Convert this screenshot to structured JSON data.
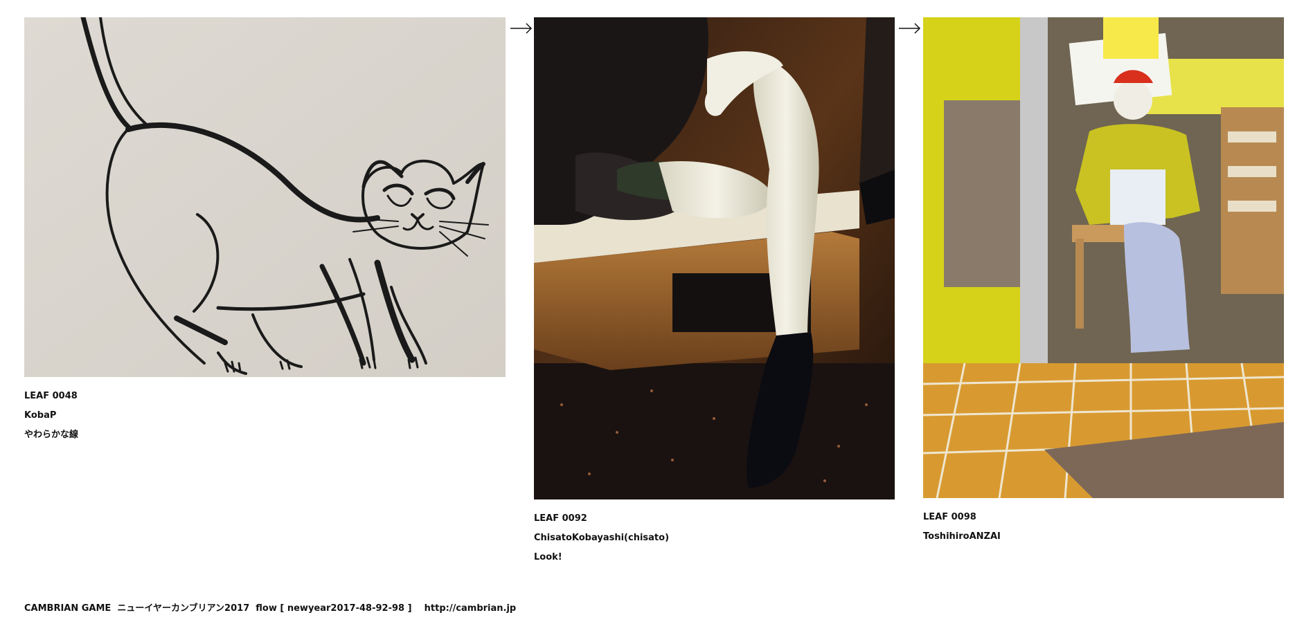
{
  "leaves": [
    {
      "id": "LEAF 0048",
      "author": "KobaP",
      "title": "やわらかな線"
    },
    {
      "id": "LEAF 0092",
      "author": "ChisatoKobayashi(chisato)",
      "title": "Look!"
    },
    {
      "id": "LEAF 0098",
      "author": "ToshihiroANZAI",
      "title": ""
    }
  ],
  "arrows": [
    "→",
    "→"
  ],
  "footer": {
    "text": "CAMBRIAN GAME  ニューイヤーカンブリアン2017  flow [ newyear2017-48-92-98 ]    http://cambrian.jp"
  },
  "colors": {
    "background": "#ffffff",
    "text": "#111111",
    "cat_wall": "#d9d4cc",
    "ink": "#1a1a1a"
  }
}
